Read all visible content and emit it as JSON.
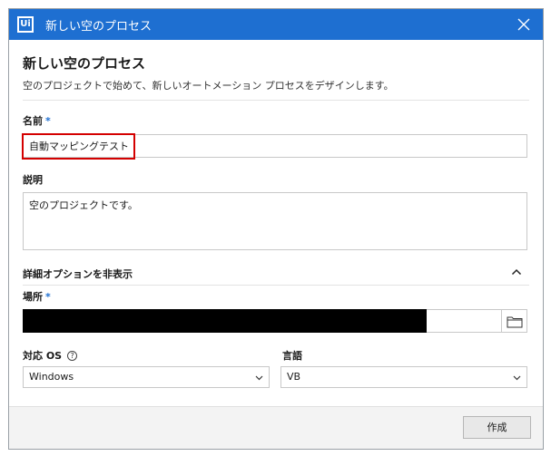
{
  "window": {
    "app_logo": "Ui",
    "title": "新しい空のプロセス",
    "close_icon": "close-icon"
  },
  "header": {
    "heading": "新しい空のプロセス",
    "subheading": "空のプロジェクトで始めて、新しいオートメーション プロセスをデザインします。"
  },
  "form": {
    "name": {
      "label": "名前",
      "required_mark": "*",
      "value": "自動マッピングテスト"
    },
    "description": {
      "label": "説明",
      "value": "空のプロジェクトです。"
    },
    "advanced_toggle": {
      "label": "詳細オプションを非表示",
      "icon": "chevron-up-icon"
    },
    "location": {
      "label": "場所",
      "required_mark": "*",
      "value": "",
      "browse_icon": "folder-icon"
    },
    "os": {
      "label": "対応 OS",
      "help_icon": "?",
      "selected": "Windows"
    },
    "language": {
      "label": "言語",
      "selected": "VB"
    }
  },
  "footer": {
    "create_label": "作成"
  },
  "colors": {
    "accent": "#1e6fd1",
    "highlight_box": "#d40000",
    "footer_bg": "#f3f3f3"
  }
}
